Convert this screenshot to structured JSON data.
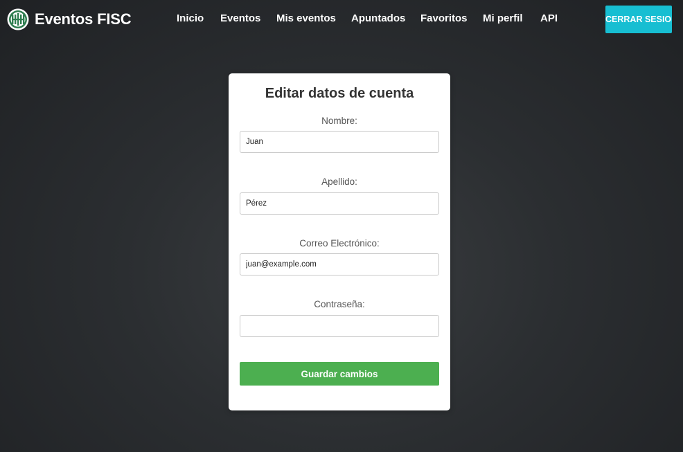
{
  "nav": {
    "brand": "Eventos FISC",
    "links": [
      "Inicio",
      "Eventos",
      "Mis eventos",
      "Apuntados",
      "Favoritos",
      "Mi perfil",
      "API"
    ],
    "logout_label": "CERRAR SESION"
  },
  "form": {
    "title": "Editar datos de cuenta",
    "fields": [
      {
        "label": "Nombre:",
        "value": "Juan"
      },
      {
        "label": "Apellido:",
        "value": "Pérez"
      },
      {
        "label": "Correo Electrónico:",
        "value": "juan@example.com"
      },
      {
        "label": "Contraseña:",
        "value": ""
      }
    ],
    "submit_label": "Guardar cambios"
  },
  "colors": {
    "accent_logout": "#17bed2",
    "submit_green": "#4caf50",
    "logo_green": "#2e7d4f"
  },
  "icons": {
    "logo": "fisc-logo-icon"
  }
}
